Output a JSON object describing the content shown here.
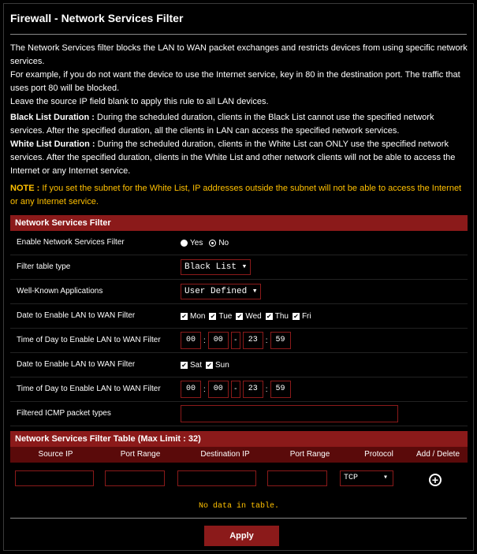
{
  "title": "Firewall - Network Services Filter",
  "desc": {
    "p1": "The Network Services filter blocks the LAN to WAN packet exchanges and restricts devices from using specific network services.",
    "p2": "For example, if you do not want the device to use the Internet service, key in 80 in the destination port. The traffic that uses port 80 will be blocked.",
    "p3": "Leave the source IP field blank to apply this rule to all LAN devices.",
    "black_label": "Black List Duration :",
    "black_text": " During the scheduled duration, clients in the Black List cannot use the specified network services. After the specified duration, all the clients in LAN can access the specified network services.",
    "white_label": "White List Duration :",
    "white_text": " During the scheduled duration, clients in the White List can ONLY use the specified network services. After the specified duration, clients in the White List and other network clients will not be able to access the Internet or any Internet service.",
    "note_label": "NOTE :",
    "note_text": " If you set the subnet for the White List, IP addresses outside the subnet will not be able to access the Internet or any Internet service."
  },
  "section1": "Network Services Filter",
  "rows": {
    "enable": "Enable Network Services Filter",
    "yes": "Yes",
    "no": "No",
    "filter_type": "Filter table type",
    "filter_type_value": "Black List",
    "apps": "Well-Known Applications",
    "apps_value": "User Defined",
    "date1": "Date to Enable LAN to WAN Filter",
    "days1": [
      "Mon",
      "Tue",
      "Wed",
      "Thu",
      "Fri"
    ],
    "time1": "Time of Day to Enable LAN to WAN Filter",
    "time1_vals": [
      "00",
      "00",
      "23",
      "59"
    ],
    "date2": "Date to Enable LAN to WAN Filter",
    "days2": [
      "Sat",
      "Sun"
    ],
    "time2": "Time of Day to Enable LAN to WAN Filter",
    "time2_vals": [
      "00",
      "00",
      "23",
      "59"
    ],
    "icmp": "Filtered ICMP packet types"
  },
  "section2": "Network Services Filter Table (Max Limit : 32)",
  "table": {
    "headers": [
      "Source IP",
      "Port Range",
      "Destination IP",
      "Port Range",
      "Protocol",
      "Add / Delete"
    ],
    "protocol_value": "TCP",
    "no_data": "No data in table."
  },
  "apply": "Apply"
}
